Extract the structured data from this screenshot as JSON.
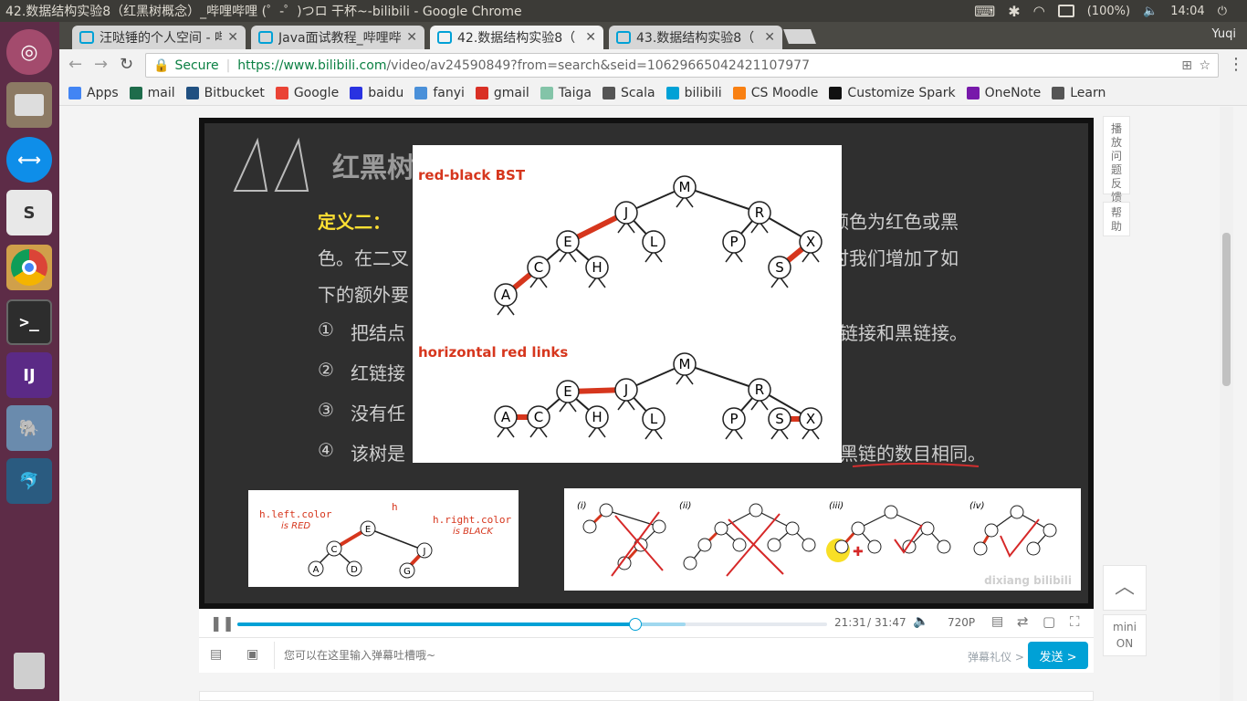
{
  "window": {
    "title": "42.数据结构实验8（红黑树概念）_哔哩哔哩 (゜-゜)つロ 干杯~-bilibili - Google Chrome",
    "battery": "(100%)",
    "clock": "14:04"
  },
  "browser": {
    "tabs": [
      {
        "label": "汪哒锤的个人空间 - 哔"
      },
      {
        "label": "Java面试教程_哔哩哔"
      },
      {
        "label": "42.数据结构实验8（"
      },
      {
        "label": "43.数据结构实验8（"
      }
    ],
    "user": "Yuqi",
    "secure_label": "Secure",
    "url_host": "https://www.bilibili.com",
    "url_rest": "/video/av24590849?from=search&seid=10629665042421107977"
  },
  "bookmarks": [
    {
      "label": "Apps",
      "color": "#4285f4"
    },
    {
      "label": "mail",
      "color": "#1e6c4b"
    },
    {
      "label": "Bitbucket",
      "color": "#205081"
    },
    {
      "label": "Google",
      "color": "#ea4335"
    },
    {
      "label": "baidu",
      "color": "#2932e1"
    },
    {
      "label": "fanyi",
      "color": "#4a90d9"
    },
    {
      "label": "gmail",
      "color": "#d93025"
    },
    {
      "label": "Taiga",
      "color": "#83c4a8"
    },
    {
      "label": "Scala",
      "color": "#555555"
    },
    {
      "label": "bilibili",
      "color": "#00a1d6"
    },
    {
      "label": "CS Moodle",
      "color": "#f98012"
    },
    {
      "label": "Customize Spark",
      "color": "#111111"
    },
    {
      "label": "OneNote",
      "color": "#7719aa"
    },
    {
      "label": "Learn",
      "color": "#555555"
    }
  ],
  "video": {
    "chalk_title": "红黑树",
    "chalk_def_label": "定义二：",
    "chalk_line1_tail": "颜色为红色或黑",
    "chalk_line2_head": "色。在二叉",
    "chalk_line2_tail": "时我们增加了如",
    "chalk_line3_head": "下的额外要",
    "item1_num": "①",
    "item1_head": "把结点",
    "item1_tail": "链接和黑链接。",
    "item2_num": "②",
    "item2_head": "红链接",
    "item3_num": "③",
    "item3_head": "没有任",
    "item4_num": "④",
    "item4_head": "该树是",
    "item4_tail": "黑链的数目相同。",
    "slide_heading1": "red-black BST",
    "slide_heading2": "horizontal red links",
    "left_label1": "h.left.color",
    "left_label1b": "is RED",
    "left_label_h": "h",
    "left_label2": "h.right.color",
    "left_label2b": "is BLACK",
    "right_labels": [
      "(i)",
      "(ii)",
      "(iii)",
      "(iv)"
    ],
    "watermark": "dixiang bilibili",
    "progress_fraction": 0.675,
    "buffer_fraction": 0.76,
    "time_current": "21:31",
    "time_sep": "/",
    "time_total": "31:47",
    "quality": "720P"
  },
  "danmaku": {
    "placeholder": "您可以在这里输入弹幕吐槽哦~",
    "etiquette": "弹幕礼仪 >",
    "send": "发送 >"
  },
  "side": {
    "feedback": "播放问题反馈",
    "help": "帮助",
    "mini": "mini",
    "mini_state": "ON"
  }
}
